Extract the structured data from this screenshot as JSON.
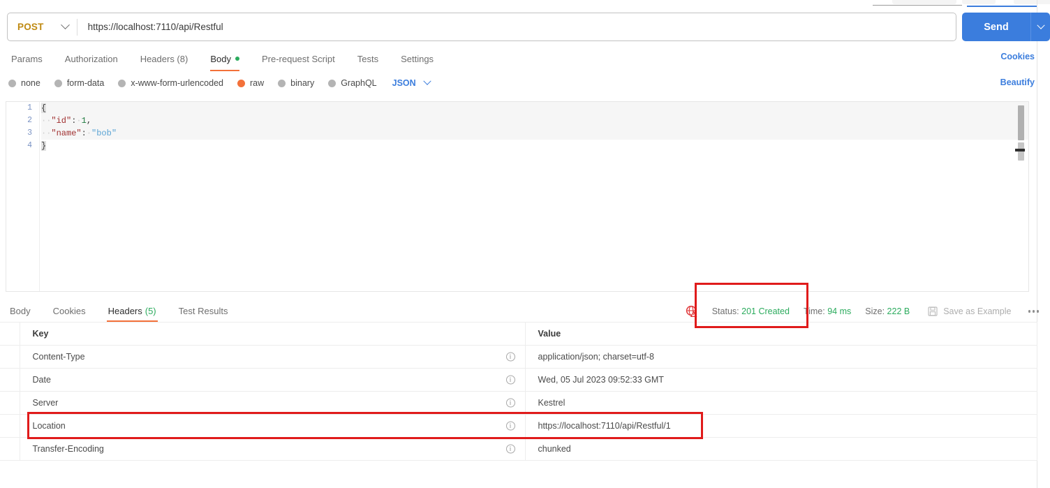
{
  "request": {
    "method": "POST",
    "url": "https://localhost:7110/api/Restful",
    "send_label": "Send",
    "send_caret_icon": "chevron-down-icon",
    "method_caret_icon": "chevron-down-icon",
    "tabs": [
      {
        "label": "Params",
        "active": false
      },
      {
        "label": "Authorization",
        "active": false
      },
      {
        "label": "Headers (8)",
        "active": false
      },
      {
        "label": "Body",
        "active": true,
        "dot": true
      },
      {
        "label": "Pre-request Script",
        "active": false
      },
      {
        "label": "Tests",
        "active": false
      },
      {
        "label": "Settings",
        "active": false
      }
    ],
    "cookies_label": "Cookies",
    "beautify_label": "Beautify",
    "body_modes": [
      {
        "label": "none",
        "selected": false
      },
      {
        "label": "form-data",
        "selected": false
      },
      {
        "label": "x-www-form-urlencoded",
        "selected": false
      },
      {
        "label": "raw",
        "selected": true
      },
      {
        "label": "binary",
        "selected": false
      },
      {
        "label": "GraphQL",
        "selected": false
      }
    ],
    "raw_format": "JSON",
    "body_lines": [
      {
        "n": "1",
        "text": "{"
      },
      {
        "n": "2",
        "text": "  \"id\": 1,"
      },
      {
        "n": "3",
        "text": "  \"name\": \"bob\""
      },
      {
        "n": "4",
        "text": "}"
      }
    ]
  },
  "response": {
    "tabs": [
      {
        "label": "Body",
        "count": "",
        "active": false
      },
      {
        "label": "Cookies",
        "count": "",
        "active": false
      },
      {
        "label": "Headers",
        "count": "(5)",
        "active": true
      },
      {
        "label": "Test Results",
        "count": "",
        "active": false
      }
    ],
    "status_icon": "globe-warning-icon",
    "status_prefix": "Status:",
    "status_value": "201 Created",
    "time_prefix": "Time:",
    "time_value": "94 ms",
    "size_prefix": "Size:",
    "size_value": "222 B",
    "save_icon": "save-disk-icon",
    "save_label": "Save as Example",
    "more_icon": "ellipsis-icon",
    "table": {
      "columns": [
        "Key",
        "Value"
      ],
      "info_icon": "info-icon",
      "rows": [
        {
          "key": "Content-Type",
          "value": "application/json; charset=utf-8",
          "highlight": false
        },
        {
          "key": "Date",
          "value": "Wed, 05 Jul 2023 09:52:33 GMT",
          "highlight": false
        },
        {
          "key": "Server",
          "value": "Kestrel",
          "highlight": false
        },
        {
          "key": "Location",
          "value": "https://localhost:7110/api/Restful/1",
          "highlight": true
        },
        {
          "key": "Transfer-Encoding",
          "value": "chunked",
          "highlight": false
        }
      ]
    }
  },
  "annotations": {
    "box_color": "#e01b1b",
    "boxes": [
      "status-badge-highlight",
      "location-header-row-highlight"
    ]
  },
  "theme": {
    "accent_blue": "#3b7ddd",
    "accent_orange": "#f3713a",
    "method_color": "#bf8a12",
    "success_green": "#2bab5d",
    "annotation_red": "#e01b1b"
  }
}
